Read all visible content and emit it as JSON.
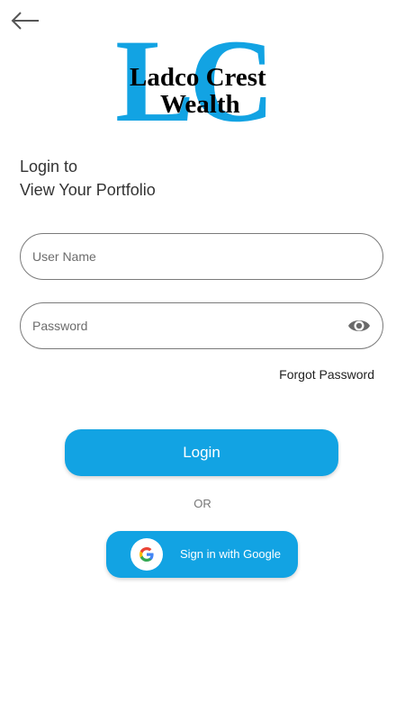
{
  "header": {
    "back_icon": "arrow-left-icon"
  },
  "logo": {
    "monogram": "LC",
    "line1": "Ladco Crest",
    "line2": "Wealth",
    "monogram_color": "#12a3e3"
  },
  "heading": {
    "line1": "Login to",
    "line2": "View Your Portfolio"
  },
  "form": {
    "username_placeholder": "User Name",
    "password_placeholder": "Password",
    "password_toggle_icon": "eye-icon",
    "forgot_password_label": "Forgot Password"
  },
  "actions": {
    "login_label": "Login",
    "or_label": "OR",
    "google_label": "Sign in with Google",
    "google_icon": "google-g-icon",
    "accent_color": "#12a3e3"
  }
}
